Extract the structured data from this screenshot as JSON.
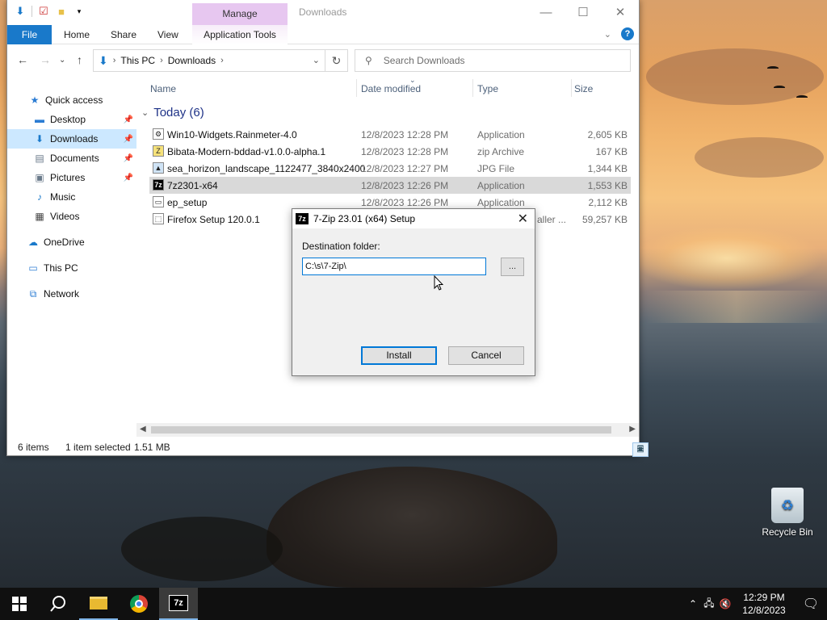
{
  "explorer": {
    "title": "Downloads",
    "manage_tab": "Manage",
    "ribbon": {
      "file": "File",
      "home": "Home",
      "share": "Share",
      "view": "View",
      "app_tools": "Application Tools"
    },
    "address": {
      "crumbs": [
        "This PC",
        "Downloads"
      ]
    },
    "search": {
      "placeholder": "Search Downloads"
    },
    "nav": [
      {
        "label": "Quick access"
      },
      {
        "label": "Desktop"
      },
      {
        "label": "Downloads"
      },
      {
        "label": "Documents"
      },
      {
        "label": "Pictures"
      },
      {
        "label": "Music"
      },
      {
        "label": "Videos"
      },
      {
        "label": "OneDrive"
      },
      {
        "label": "This PC"
      },
      {
        "label": "Network"
      }
    ],
    "columns": {
      "name": "Name",
      "date": "Date modified",
      "type": "Type",
      "size": "Size"
    },
    "group": "Today (6)",
    "files": [
      {
        "name": "Win10-Widgets.Rainmeter-4.0",
        "date": "12/8/2023 12:28 PM",
        "type": "Application",
        "size": "2,605 KB"
      },
      {
        "name": "Bibata-Modern-bddad-v1.0.0-alpha.1",
        "date": "12/8/2023 12:28 PM",
        "type": "zip Archive",
        "size": "167 KB"
      },
      {
        "name": "sea_horizon_landscape_1122477_3840x2400",
        "date": "12/8/2023 12:27 PM",
        "type": "JPG File",
        "size": "1,344 KB"
      },
      {
        "name": "7z2301-x64",
        "date": "12/8/2023 12:26 PM",
        "type": "Application",
        "size": "1,553 KB"
      },
      {
        "name": "ep_setup",
        "date": "12/8/2023 12:26 PM",
        "type": "Application",
        "size": "2,112 KB"
      },
      {
        "name": "Firefox Setup 120.0.1",
        "date": "",
        "type": "aller ...",
        "size": "59,257 KB"
      }
    ],
    "status": {
      "items": "6 items",
      "selected": "1 item selected",
      "size": "1.51 MB"
    }
  },
  "dialog": {
    "title": "7-Zip 23.01 (x64) Setup",
    "app_icon_text": "7z",
    "dest_label": "Destination folder:",
    "dest_value": "C:\\s\\7-Zip\\",
    "browse": "...",
    "install": "Install",
    "cancel": "Cancel"
  },
  "desktop": {
    "recycle_bin": "Recycle Bin"
  },
  "taskbar": {
    "time": "12:29 PM",
    "date": "12/8/2023",
    "active_app_label": "7z"
  },
  "colors": {
    "accent": "#1979ca",
    "selection": "#cce8ff",
    "manage": "#e7c7f0"
  }
}
